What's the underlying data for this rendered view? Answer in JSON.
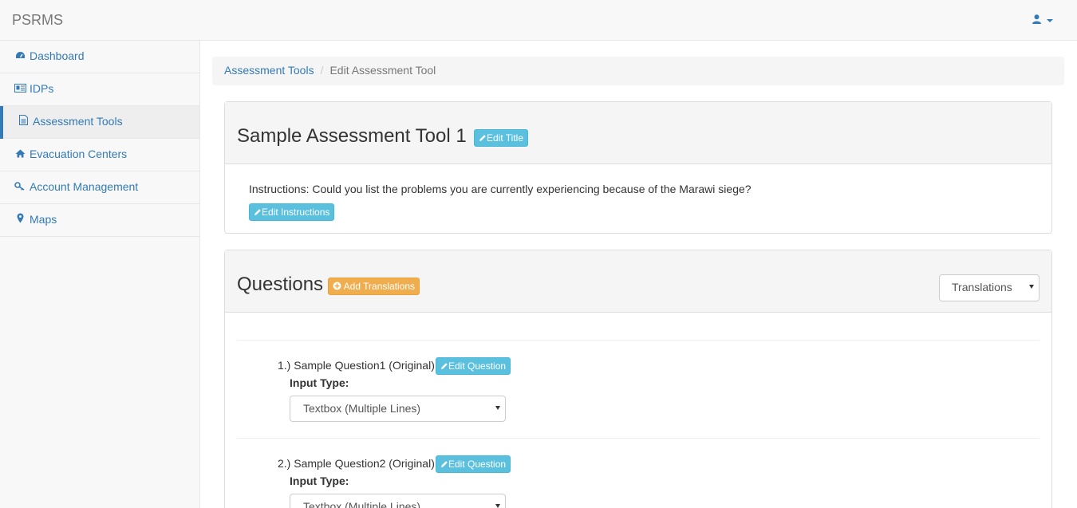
{
  "app": {
    "brand": "PSRMS"
  },
  "sidebar": {
    "items": [
      {
        "label": "Dashboard",
        "icon": "dashboard-icon"
      },
      {
        "label": "IDPs",
        "icon": "id-card-icon"
      },
      {
        "label": "Assessment Tools",
        "icon": "document-icon",
        "active": true
      },
      {
        "label": "Evacuation Centers",
        "icon": "home-icon"
      },
      {
        "label": "Account Management",
        "icon": "key-icon"
      },
      {
        "label": "Maps",
        "icon": "map-marker-icon"
      }
    ]
  },
  "breadcrumb": {
    "parent": "Assessment Tools",
    "separator": "/",
    "current": "Edit Assessment Tool"
  },
  "tool": {
    "title": "Sample Assessment Tool 1",
    "edit_title_label": "Edit Title",
    "instructions": "Instructions: Could you list the problems you are currently experiencing because of the Marawi siege?",
    "edit_instructions_label": "Edit Instructions"
  },
  "questions": {
    "heading": "Questions",
    "add_translations_label": "Add Translations",
    "translations_select": "Translations",
    "items": [
      {
        "label": "1.) Sample Question1 (Original)",
        "edit_label": "Edit Question",
        "input_type_label": "Input Type:",
        "input_type_value": "Textbox (Multiple Lines)"
      },
      {
        "label": "2.) Sample Question2 (Original)",
        "edit_label": "Edit Question",
        "input_type_label": "Input Type:",
        "input_type_value": "Textbox (Multiple Lines)"
      }
    ]
  },
  "colors": {
    "link": "#337ab7",
    "info": "#5bc0de",
    "warning": "#f0ad4e"
  }
}
